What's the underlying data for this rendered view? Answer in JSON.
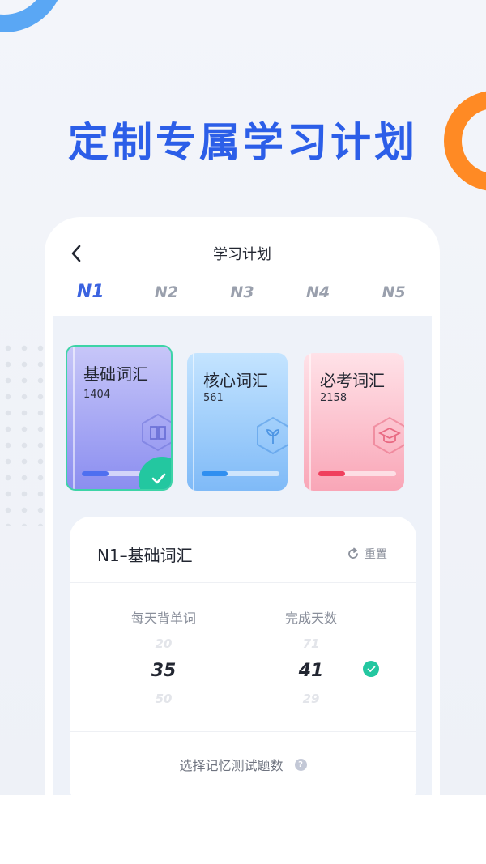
{
  "promo": {
    "headline": "定制专属学习计划"
  },
  "nav": {
    "title": "学习计划",
    "back_icon": "chevron-left-icon"
  },
  "levels": [
    {
      "label": "N1",
      "active": true
    },
    {
      "label": "N2",
      "active": false
    },
    {
      "label": "N3",
      "active": false
    },
    {
      "label": "N4",
      "active": false
    },
    {
      "label": "N5",
      "active": false
    }
  ],
  "books": [
    {
      "name": "基础词汇",
      "count": "1404",
      "icon": "book-icon",
      "progress": 0.32,
      "accent": "#4f6ff0",
      "selected": true
    },
    {
      "name": "核心词汇",
      "count": "561",
      "icon": "sprout-icon",
      "progress": 0.33,
      "accent": "#2f8ff0",
      "selected": false
    },
    {
      "name": "必考词汇",
      "count": "2158",
      "icon": "graduation-cap-icon",
      "progress": 0.34,
      "accent": "#f0405e",
      "selected": false
    }
  ],
  "plan": {
    "title": "N1–基础词汇",
    "reset_label": "重置",
    "daily_words": {
      "label": "每天背单词",
      "above": "20",
      "selected": "35",
      "below": "50"
    },
    "finish_days": {
      "label": "完成天数",
      "above": "71",
      "selected": "41",
      "below": "29"
    },
    "quiz_label": "选择记忆测试题数",
    "help_glyph": "?"
  },
  "colors": {
    "headline": "#2c5ee8",
    "active_tab": "#3b63e0",
    "success": "#23c7a0"
  }
}
